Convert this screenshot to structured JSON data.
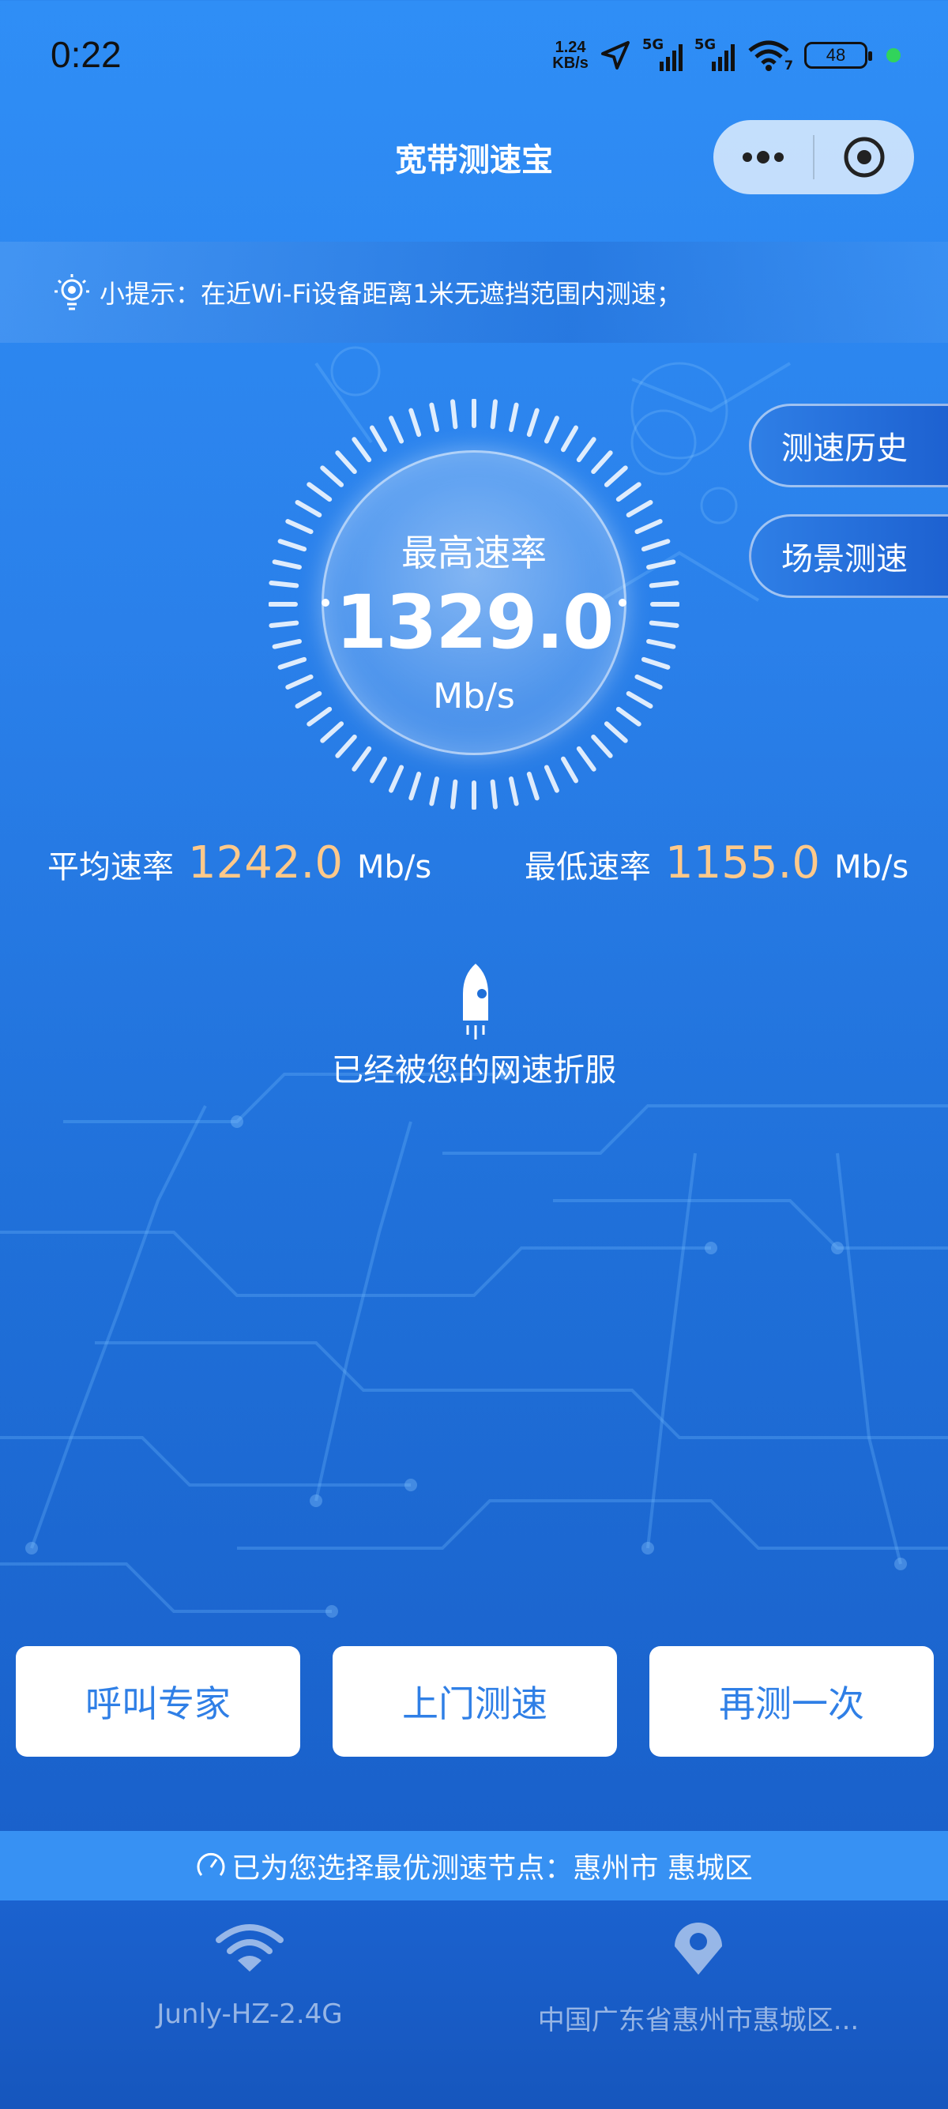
{
  "status_bar": {
    "time": "0:22",
    "net_speed_value": "1.24",
    "net_speed_unit": "KB/s",
    "signal1_label": "5G",
    "signal2_label": "5G",
    "wifi_label": "7",
    "battery": "48"
  },
  "header": {
    "title": "宽带测速宝"
  },
  "tip": {
    "text": "小提示：在近Wi-Fi设备距离1米无遮挡范围内测速；"
  },
  "gauge": {
    "label": "最高速率",
    "value": "1329.0",
    "unit": "Mb/s"
  },
  "side_buttons": {
    "history": "测速历史",
    "scene": "场景测速"
  },
  "stats": {
    "avg_label": "平均速率",
    "avg_value": "1242.0",
    "avg_unit": "Mb/s",
    "min_label": "最低速率",
    "min_value": "1155.0",
    "min_unit": "Mb/s"
  },
  "rocket": {
    "text": "已经被您的网速折服"
  },
  "actions": {
    "call_expert": "呼叫专家",
    "onsite_test": "上门测速",
    "retest": "再测一次"
  },
  "node": {
    "text": "已为您选择最优测速节点：惠州市 惠城区"
  },
  "bottom": {
    "wifi_name": "Junly-HZ-2.4G",
    "location": "中国广东省惠州市惠城区..."
  },
  "colors": {
    "accent_orange": "#ffc98a",
    "button_text_blue": "#2f7fe6",
    "node_bar": "#3791f3"
  }
}
